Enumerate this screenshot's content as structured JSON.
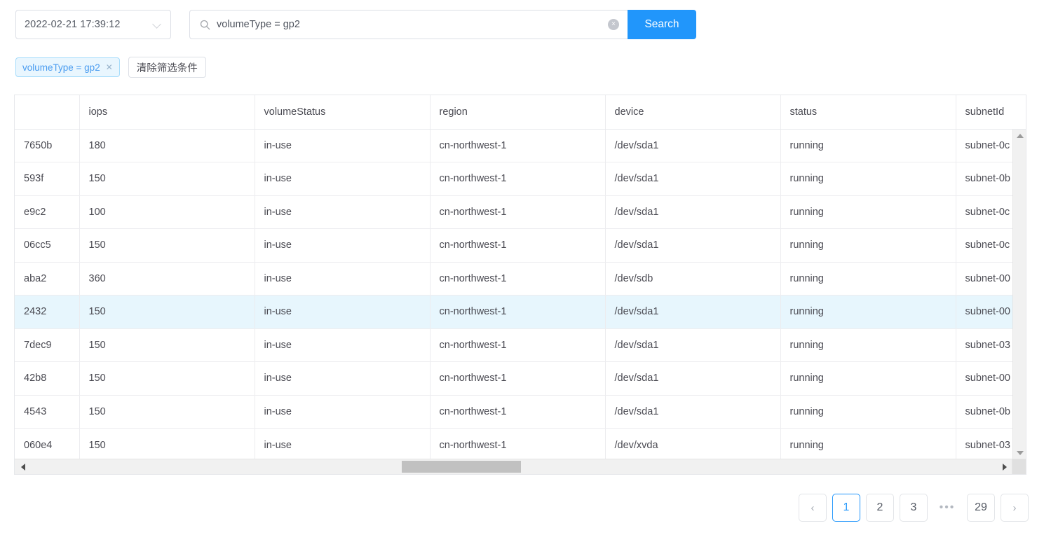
{
  "toolbar": {
    "date_value": "2022-02-21 17:39:12",
    "chevron_icon": "chevron-down-icon",
    "search_icon": "search-icon",
    "search_value": "volumeType = gp2",
    "search_placeholder": "",
    "clear_icon_glyph": "×",
    "search_button_label": "Search",
    "accent_color": "#2196fb"
  },
  "filters": {
    "tag_label": "volumeType = gp2",
    "tag_close_glyph": "✕",
    "clear_button_label": "清除筛选条件",
    "tag_text_color": "#4a9cf0",
    "tag_bg_color": "#e9f6fe"
  },
  "table": {
    "columns": [
      "",
      "iops",
      "volumeStatus",
      "region",
      "device",
      "status",
      "subnetId"
    ],
    "highlight_row_index": 5,
    "highlight_color": "#e7f6fd",
    "rows": [
      {
        "id": "7650b",
        "iops": "180",
        "volumeStatus": "in-use",
        "region": "cn-northwest-1",
        "device": "/dev/sda1",
        "status": "running",
        "subnetId": "subnet-0c"
      },
      {
        "id": "593f",
        "iops": "150",
        "volumeStatus": "in-use",
        "region": "cn-northwest-1",
        "device": "/dev/sda1",
        "status": "running",
        "subnetId": "subnet-0b"
      },
      {
        "id": "e9c2",
        "iops": "100",
        "volumeStatus": "in-use",
        "region": "cn-northwest-1",
        "device": "/dev/sda1",
        "status": "running",
        "subnetId": "subnet-0c"
      },
      {
        "id": "06cc5",
        "iops": "150",
        "volumeStatus": "in-use",
        "region": "cn-northwest-1",
        "device": "/dev/sda1",
        "status": "running",
        "subnetId": "subnet-0c"
      },
      {
        "id": "aba2",
        "iops": "360",
        "volumeStatus": "in-use",
        "region": "cn-northwest-1",
        "device": "/dev/sdb",
        "status": "running",
        "subnetId": "subnet-00"
      },
      {
        "id": "2432",
        "iops": "150",
        "volumeStatus": "in-use",
        "region": "cn-northwest-1",
        "device": "/dev/sda1",
        "status": "running",
        "subnetId": "subnet-00"
      },
      {
        "id": "7dec9",
        "iops": "150",
        "volumeStatus": "in-use",
        "region": "cn-northwest-1",
        "device": "/dev/sda1",
        "status": "running",
        "subnetId": "subnet-03"
      },
      {
        "id": "42b8",
        "iops": "150",
        "volumeStatus": "in-use",
        "region": "cn-northwest-1",
        "device": "/dev/sda1",
        "status": "running",
        "subnetId": "subnet-00"
      },
      {
        "id": "4543",
        "iops": "150",
        "volumeStatus": "in-use",
        "region": "cn-northwest-1",
        "device": "/dev/sda1",
        "status": "running",
        "subnetId": "subnet-0b"
      },
      {
        "id": "060e4",
        "iops": "150",
        "volumeStatus": "in-use",
        "region": "cn-northwest-1",
        "device": "/dev/xvda",
        "status": "running",
        "subnetId": "subnet-03"
      }
    ]
  },
  "scrollbars": {
    "vertical_up_icon": "triangle-up-icon",
    "vertical_down_icon": "triangle-down-icon",
    "horizontal_left_icon": "triangle-left-icon",
    "horizontal_right_icon": "triangle-right-icon"
  },
  "pagination": {
    "prev_label": "‹",
    "next_label": "›",
    "pages": [
      "1",
      "2",
      "3"
    ],
    "ellipsis": "•••",
    "last_page": "29",
    "current_page": "1",
    "active_color": "#2196fb"
  }
}
